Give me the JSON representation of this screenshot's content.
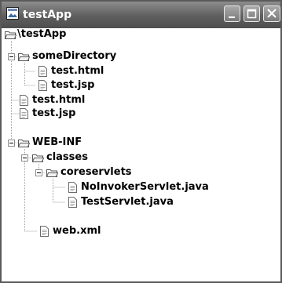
{
  "window": {
    "title": "testApp",
    "controls": [
      "minimize-icon",
      "maximize-icon",
      "close-icon"
    ]
  },
  "tree": {
    "root": "\\testApp",
    "items": [
      {
        "label": "someDirectory",
        "type": "folder",
        "expanded": true
      },
      {
        "label": "test.html",
        "type": "file"
      },
      {
        "label": "test.jsp",
        "type": "file"
      },
      {
        "label": "test.html",
        "type": "file"
      },
      {
        "label": "test.jsp",
        "type": "file"
      },
      {
        "label": "WEB-INF",
        "type": "folder",
        "expanded": true
      },
      {
        "label": "classes",
        "type": "folder",
        "expanded": true
      },
      {
        "label": "coreservlets",
        "type": "folder",
        "expanded": true
      },
      {
        "label": "NoInvokerServlet.java",
        "type": "file"
      },
      {
        "label": "TestServlet.java",
        "type": "file"
      },
      {
        "label": "web.xml",
        "type": "file"
      }
    ]
  }
}
